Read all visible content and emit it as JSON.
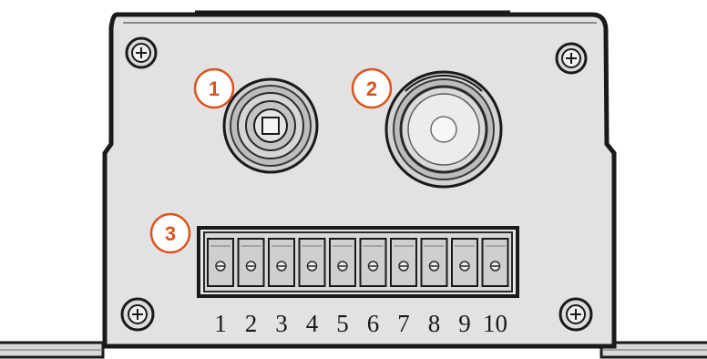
{
  "colors": {
    "callout": "#d9541e",
    "line": "#1a1a1a",
    "panel": "#e2e2e2",
    "terminal_fill": "#cfcfcf"
  },
  "callouts": [
    "1",
    "2",
    "3"
  ],
  "terminal_block": {
    "labels": [
      "1",
      "2",
      "3",
      "4",
      "5",
      "6",
      "7",
      "8",
      "9",
      "10"
    ]
  }
}
